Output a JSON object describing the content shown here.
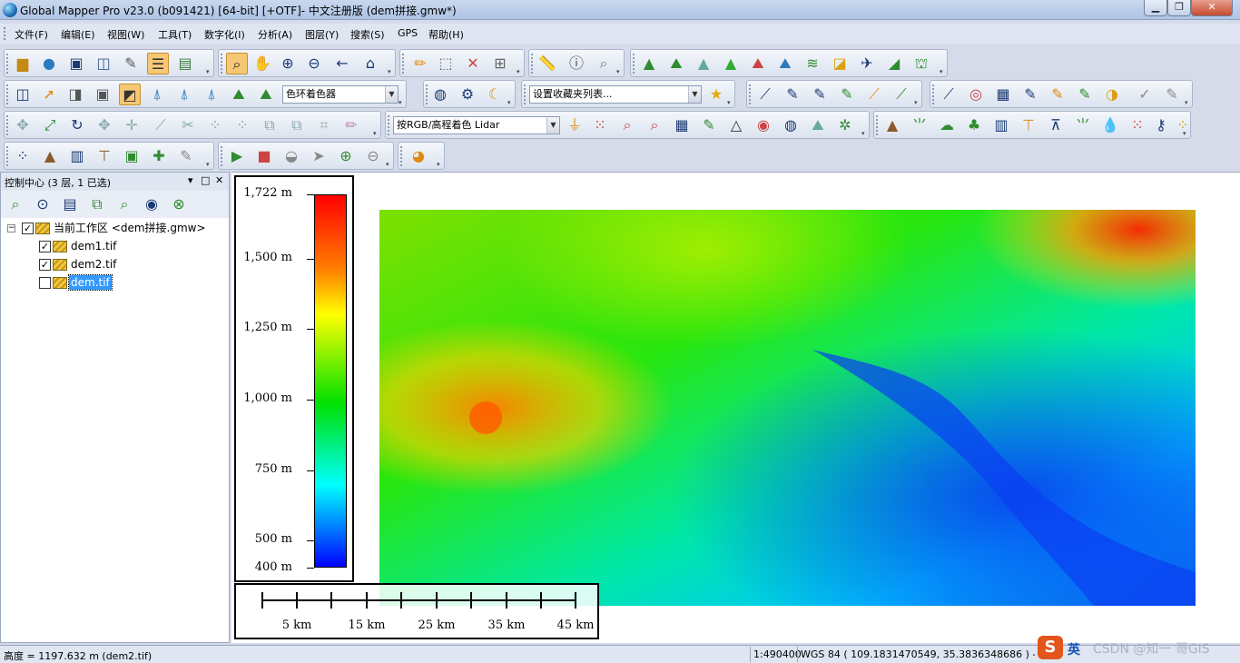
{
  "window": {
    "title": "Global Mapper Pro v23.0 (b091421) [64-bit] [+OTF]- 中文注册版 (dem拼接.gmw*)",
    "minimize": "▁",
    "maximize": "❐",
    "close": "✕"
  },
  "menu": [
    "文件(F)",
    "编辑(E)",
    "视图(W)",
    "工具(T)",
    "数字化(I)",
    "分析(A)",
    "图层(Y)",
    "搜索(S)",
    "GPS",
    "帮助(H)"
  ],
  "toolbars": {
    "shader_combo": "色环着色器",
    "favorites_combo": "设置收藏夹列表...",
    "lidar_combo": "按RGB/高程着色 Lidar"
  },
  "control_center": {
    "title": "控制中心 (3 层, 1 已选)",
    "workspace_label": "当前工作区 <dem拼接.gmw>",
    "layers": [
      {
        "name": "dem1.tif",
        "checked": true,
        "selected": false
      },
      {
        "name": "dem2.tif",
        "checked": true,
        "selected": false
      },
      {
        "name": "dem.tif",
        "checked": false,
        "selected": true
      }
    ]
  },
  "legend": {
    "labels": [
      "1,722 m",
      "1,500 m",
      "1,250 m",
      "1,000 m",
      "750 m",
      "500 m",
      "400 m"
    ]
  },
  "scale_bar": {
    "labels": [
      "5 km",
      "15 km",
      "25 km",
      "35 km",
      "45 km"
    ]
  },
  "status": {
    "elevation": "高度 = 1197.632 m (dem2.tif)",
    "scale": "1:490400",
    "coords": "WGS 84 ( 109.1831470549, 35.3836348686 ) - 1197.63"
  },
  "ime": {
    "lang": "英",
    "watermark": "CSDN @知一 哥GIS"
  }
}
